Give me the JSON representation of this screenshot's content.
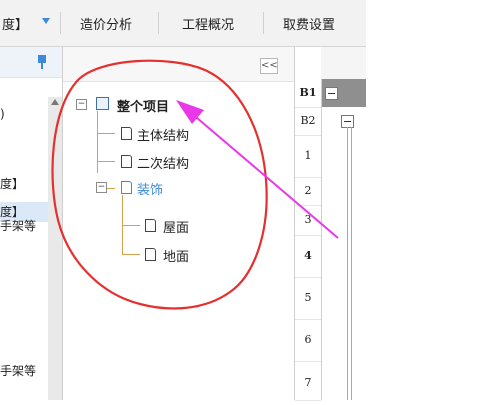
{
  "top_tabs": {
    "partial_tab": "度】",
    "tab1": "造价分析",
    "tab2": "工程概况",
    "tab3": "取费设置"
  },
  "left_list": {
    "items": [
      ")",
      "度】",
      "度】",
      "手架等",
      "手架等"
    ]
  },
  "tree": {
    "collapse_label": "<<",
    "root": "整个项目",
    "children": [
      "主体结构",
      "二次结构",
      "装饰"
    ],
    "grandchildren": [
      "屋面",
      "地面"
    ]
  },
  "grid": {
    "headers": [
      "B1",
      "B2"
    ],
    "rows": [
      "1",
      "2",
      "3",
      "4",
      "5",
      "6",
      "7"
    ]
  },
  "colors": {
    "annotation_red": "#e53030",
    "arrow_magenta": "#e838e8",
    "selected_node": "#3e8ad8"
  }
}
